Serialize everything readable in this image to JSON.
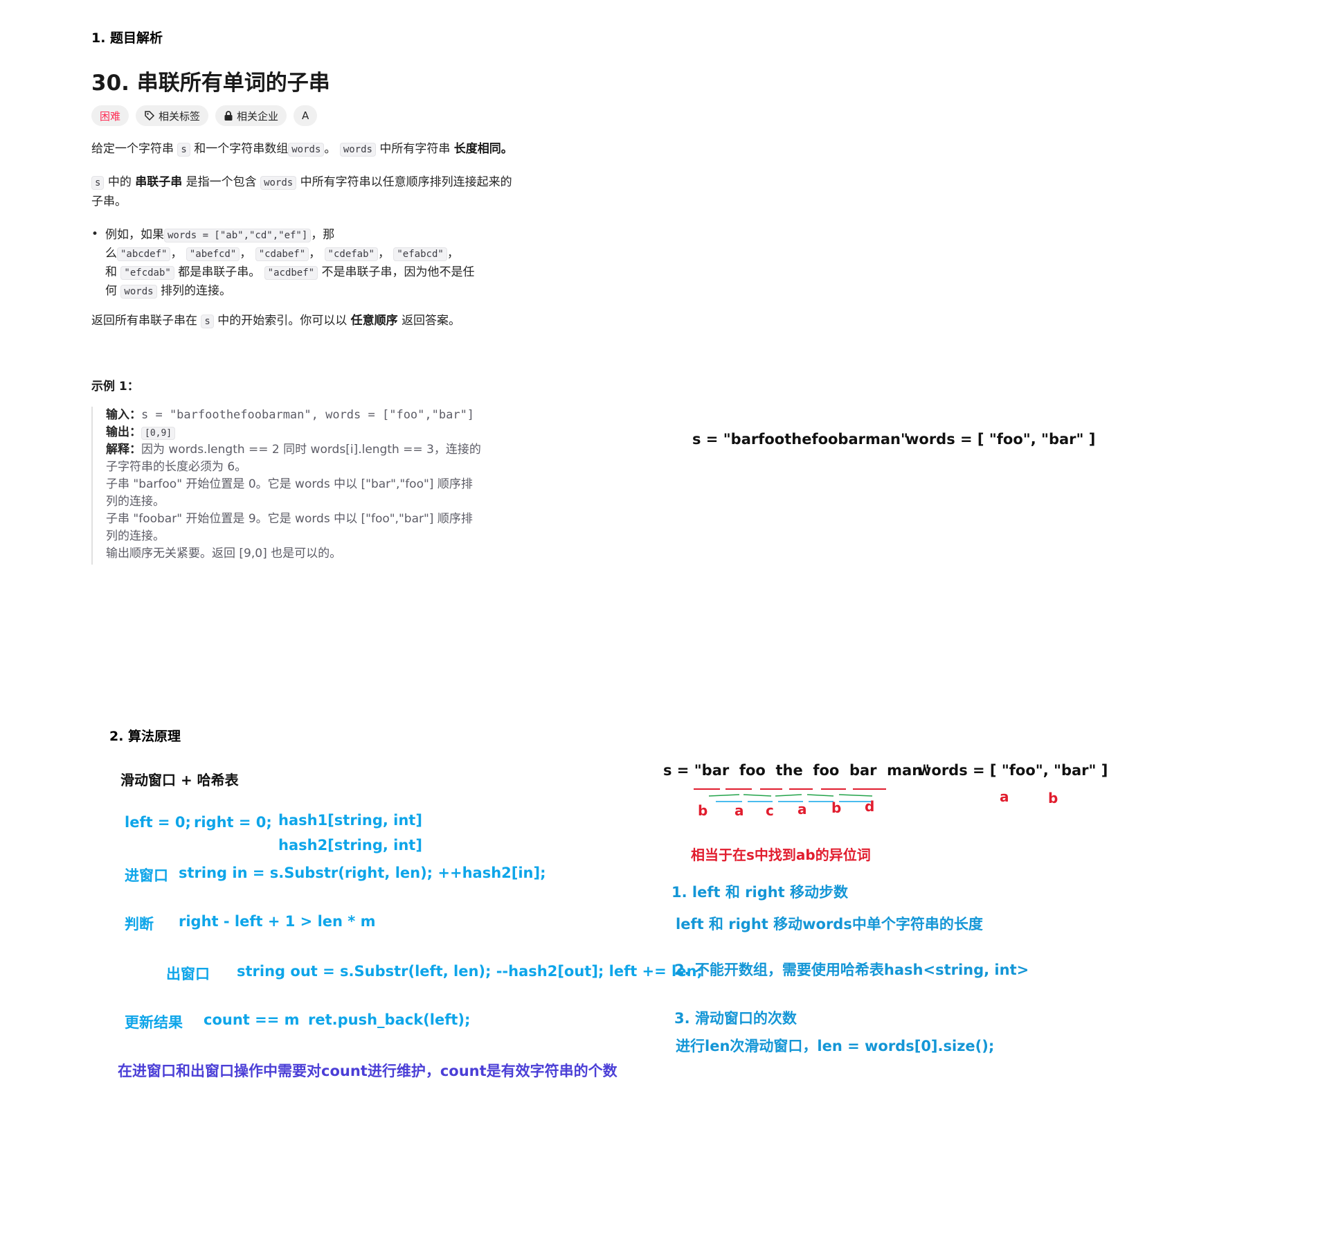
{
  "section1": {
    "heading": "1. 题目解析",
    "title": "30. 串联所有单词的子串",
    "chips": {
      "difficulty": "困难",
      "tags": "相关标签",
      "companies": "相关企业",
      "translate": "A"
    },
    "p1": {
      "t1": "给定一个字符串",
      "c1": "s",
      "t2": "和一个字符串数组",
      "c2": "words",
      "t3": "。",
      "c3": "words",
      "t4": "中所有字符串",
      "b1": "长度相同。"
    },
    "p2": {
      "c1": "s",
      "t1": "中的",
      "b1": "串联子串",
      "t2": "是指一个包含",
      "c2": "words",
      "t3": "中所有字符串以任意顺序排列连接起来的",
      "t4": "子串。"
    },
    "bullet": {
      "l1_t1": "例如，如果",
      "l1_c1": "words = [\"ab\",\"cd\",\"ef\"]",
      "l1_t2": "，那",
      "l2_t1": "么",
      "l2_c1": "\"abcdef\"",
      "l2_c2": "\"abefcd\"",
      "l2_c3": "\"cdabef\"",
      "l2_c4": "\"cdefab\"",
      "l2_c5": "\"efabcd\"",
      "l3_t1": "和",
      "l3_c1": "\"efcdab\"",
      "l3_t2": "都是串联子串。",
      "l3_c2": "\"acdbef\"",
      "l3_t3": "不是串联子串，因为他不是任",
      "l4_t1": "何",
      "l4_c1": "words",
      "l4_t2": "排列的连接。"
    },
    "p3": {
      "t1": "返回所有串联子串在",
      "c1": "s",
      "t2": "中的开始索引。你可以以",
      "b1": "任意顺序",
      "t3": "返回答案。"
    },
    "example_heading": "示例 1：",
    "example": {
      "input_label": "输入：",
      "input_value": "s = \"barfoothefoobarman\", words = [\"foo\",\"bar\"]",
      "output_label": "输出：",
      "output_value": "[0,9]",
      "explain_label": "解释：",
      "e1": "因为 words.length == 2 同时 words[i].length == 3，连接的",
      "e2": "子字符串的长度必须为 6。",
      "e3": "子串 \"barfoo\" 开始位置是 0。它是 words 中以 [\"bar\",\"foo\"] 顺序排",
      "e4": "列的连接。",
      "e5": "子串 \"foobar\" 开始位置是 9。它是 words 中以 [\"foo\",\"bar\"] 顺序排",
      "e6": "列的连接。",
      "e7": "输出顺序无关紧要。返回 [9,0] 也是可以的。"
    },
    "right_note": {
      "s": "s = \"barfoothefoobarman\"",
      "words": "words = [ \"foo\", \"bar\" ]"
    }
  },
  "section2": {
    "heading": "2. 算法原理",
    "subtitle": "滑动窗口 + 哈希表",
    "init": {
      "left": "left = 0;",
      "right": "right = 0;",
      "hash1": "hash1[string, int]",
      "hash2": "hash2[string, int]"
    },
    "enter": {
      "label": "进窗口",
      "code": "string in = s.Substr(right, len); ++hash2[in];"
    },
    "judge": {
      "label": "判断",
      "code": "right - left + 1 > len * m"
    },
    "leave": {
      "label": "出窗口",
      "code": "string out = s.Substr(left, len);  --hash2[out];   left += len;"
    },
    "update": {
      "label": "更新结果",
      "cond": "count == m",
      "code": "ret.push_back(left);"
    },
    "footer": "在进窗口和出窗口操作中需要对count进行维护，count是有效字符串的个数",
    "diagram": {
      "s_prefix": "s = \"",
      "words_list": [
        "bar",
        "foo",
        "the",
        "foo",
        "bar",
        "man"
      ],
      "s_suffix": "\"",
      "words_label": "words = [ \"foo\",  \"bar\" ]",
      "letters": [
        "b",
        "a",
        "c",
        "a",
        "b",
        "d"
      ],
      "word_letters": [
        "a",
        "b"
      ],
      "note": "相当于在s中找到ab的异位词"
    },
    "points": {
      "p1_title": "1. left 和 right 移动步数",
      "p1_desc": "left 和 right 移动words中单个字符串的长度",
      "p2_title": "2. 不能开数组，需要使用哈希表hash<string, int>",
      "p3_title": "3. 滑动窗口的次数",
      "p3_desc": "进行len次滑动窗口，len = words[0].size();"
    }
  }
}
